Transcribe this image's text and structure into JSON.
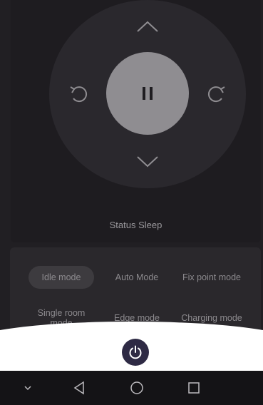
{
  "control_pad": {
    "up_icon": "chevron-up-icon",
    "down_icon": "chevron-down-icon",
    "rotate_left_icon": "rotate-left-icon",
    "rotate_right_icon": "rotate-right-icon",
    "center_icon": "pause-icon"
  },
  "status": {
    "text": "Status Sleep"
  },
  "modes": [
    {
      "label": "Idle mode",
      "active": true
    },
    {
      "label": "Auto Mode",
      "active": false
    },
    {
      "label": "Fix point mode",
      "active": false
    },
    {
      "label": "Single room mode",
      "active": false
    },
    {
      "label": "Edge mode",
      "active": false
    },
    {
      "label": "Charging mode",
      "active": false
    }
  ],
  "power": {
    "icon": "power-icon",
    "color": "#2e2a44"
  },
  "navbar": {
    "items": [
      "chevron-down-icon",
      "back-icon",
      "home-icon",
      "recents-icon"
    ]
  },
  "colors": {
    "background": "#211f23",
    "pad": "#2a282d",
    "center_button": "#8f8d91",
    "text": "#9b999d"
  }
}
